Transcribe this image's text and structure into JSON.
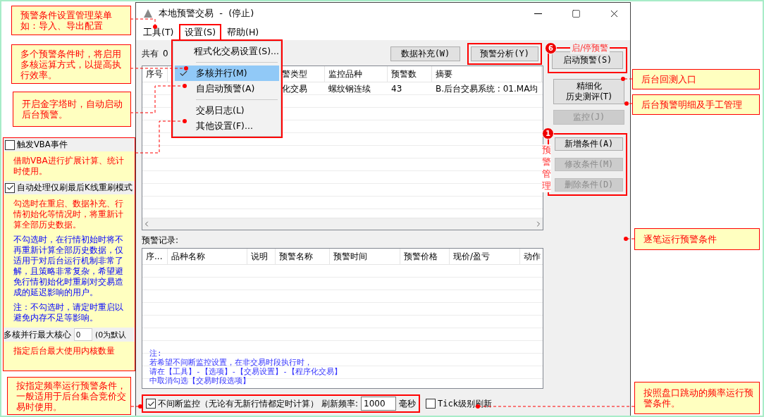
{
  "window": {
    "title": "本地预警交易  -  (停止)"
  },
  "menu_bar": [
    {
      "label": "工具(T)",
      "selected": false
    },
    {
      "label": "设置(S)",
      "selected": true
    },
    {
      "label": "帮助(H)",
      "selected": false
    }
  ],
  "settings_menu": [
    {
      "kind": "item",
      "label": "程式化交易设置(S)...",
      "checked": false,
      "selected": false
    },
    {
      "kind": "separator"
    },
    {
      "kind": "item",
      "label": "多核并行(M)",
      "checked": true,
      "selected": true
    },
    {
      "kind": "item",
      "label": "自启动预警(A)",
      "checked": false,
      "selected": false
    },
    {
      "kind": "separator"
    },
    {
      "kind": "item",
      "label": "交易日志(L)",
      "checked": false,
      "selected": false
    },
    {
      "kind": "item",
      "label": "其他设置(F)...",
      "checked": false,
      "selected": false
    }
  ],
  "summary": {
    "label": "共有",
    "count": "0"
  },
  "toolbar_buttons": [
    {
      "label": "数据补充(W)",
      "annotated": false
    },
    {
      "label": "预警分析(Y)",
      "annotated": true
    }
  ],
  "conditions_table": {
    "columns": [
      {
        "label": "序号"
      },
      {},
      {
        "label": "警类型"
      },
      {
        "label": "监控品种"
      },
      {
        "label": "预警数"
      },
      {
        "label": "摘要"
      }
    ],
    "rows": [
      [
        "",
        "",
        "化交易",
        "螺纹钢连续",
        "43",
        "B.后台交易系统 : 01.MA均"
      ]
    ]
  },
  "start_group": {
    "badge": "6",
    "caption": "启/停预警",
    "button": "启动预警(S)"
  },
  "side_buttons": [
    {
      "lines": [
        "精细化",
        "历史测评(T)"
      ],
      "disabled": false
    },
    {
      "lines": [
        "监控(J)"
      ],
      "disabled": true
    }
  ],
  "manage_group": {
    "badge": "1",
    "caption": "预警管理",
    "buttons": [
      {
        "label": "新增条件(A)",
        "disabled": false
      },
      {
        "label": "修改条件(M)",
        "disabled": true
      },
      {
        "label": "删除条件(D)",
        "disabled": true
      }
    ]
  },
  "records": {
    "label": "预警记录:",
    "columns": [
      "序...",
      "品种名称",
      "说明",
      "预警名称",
      "预警时间",
      "预警价格",
      "现价/盈亏",
      "动作"
    ],
    "note": [
      "注:",
      "若希望不间断监控设置，在非交易时段执行时，",
      "请在【工具】-【选项】-【交易设置】-【程序化交易】",
      "中取消勾选【交易时段选项】"
    ]
  },
  "bottom_bar": {
    "continuous": {
      "label": "不间断监控（无论有无新行情都定时计算）",
      "checked": true
    },
    "rate_label": "刷新频率:",
    "rate_value": "1000",
    "unit": "毫秒",
    "tick": {
      "label": "Tick级别刷新",
      "checked": false
    }
  },
  "options_panel": [
    {
      "kind": "checkbox",
      "label": "触发VBA事件",
      "checked": false
    },
    {
      "kind": "alert",
      "text": "借助VBA进行扩展计算、统计时使用。"
    },
    {
      "kind": "checkbox",
      "label": "自动处理仅刷最后K线重刷模式",
      "checked": true
    },
    {
      "kind": "alert",
      "text": "勾选时在重启、数据补充、行情初始化等情况时，将重新计算全部历史数据。"
    },
    {
      "kind": "info",
      "text": "不勾选时，在行情初始时将不再重新计算全部历史数据，仅适用于对后台运行机制非常了解，且策略非常复杂，希望避免行情初始化时重刷对交易造成的延迟影响的用户。"
    },
    {
      "kind": "info",
      "text": "注：不勾选时，请定时重启以避免内存不足等影响。"
    },
    {
      "kind": "field",
      "label": "多核并行最大核心",
      "value": "0",
      "hint": "(0为默认"
    },
    {
      "kind": "alert",
      "text": "指定后台最大使用内核数量"
    }
  ],
  "callouts": [
    {
      "lines": [
        "预警条件设置管理菜单",
        "如：导入、导出配置"
      ]
    },
    {
      "lines": [
        "多个预警条件时，将启用多核运算方式，以提高执行效率。"
      ]
    },
    {
      "lines": [
        "后台回测入口"
      ]
    },
    {
      "lines": [
        "开启金字塔时，自动启动后台预警。"
      ]
    },
    {
      "lines": [
        "后台预警明细及手工管理"
      ]
    },
    {
      "lines": [
        "逐笔运行预警条件"
      ]
    },
    {
      "lines": [
        "按指定频率运行预警条件，一般适用于后台集合竞价交易时使用。"
      ]
    },
    {
      "lines": [
        "按照盘口跳动的频率运行预警条件。"
      ]
    }
  ]
}
